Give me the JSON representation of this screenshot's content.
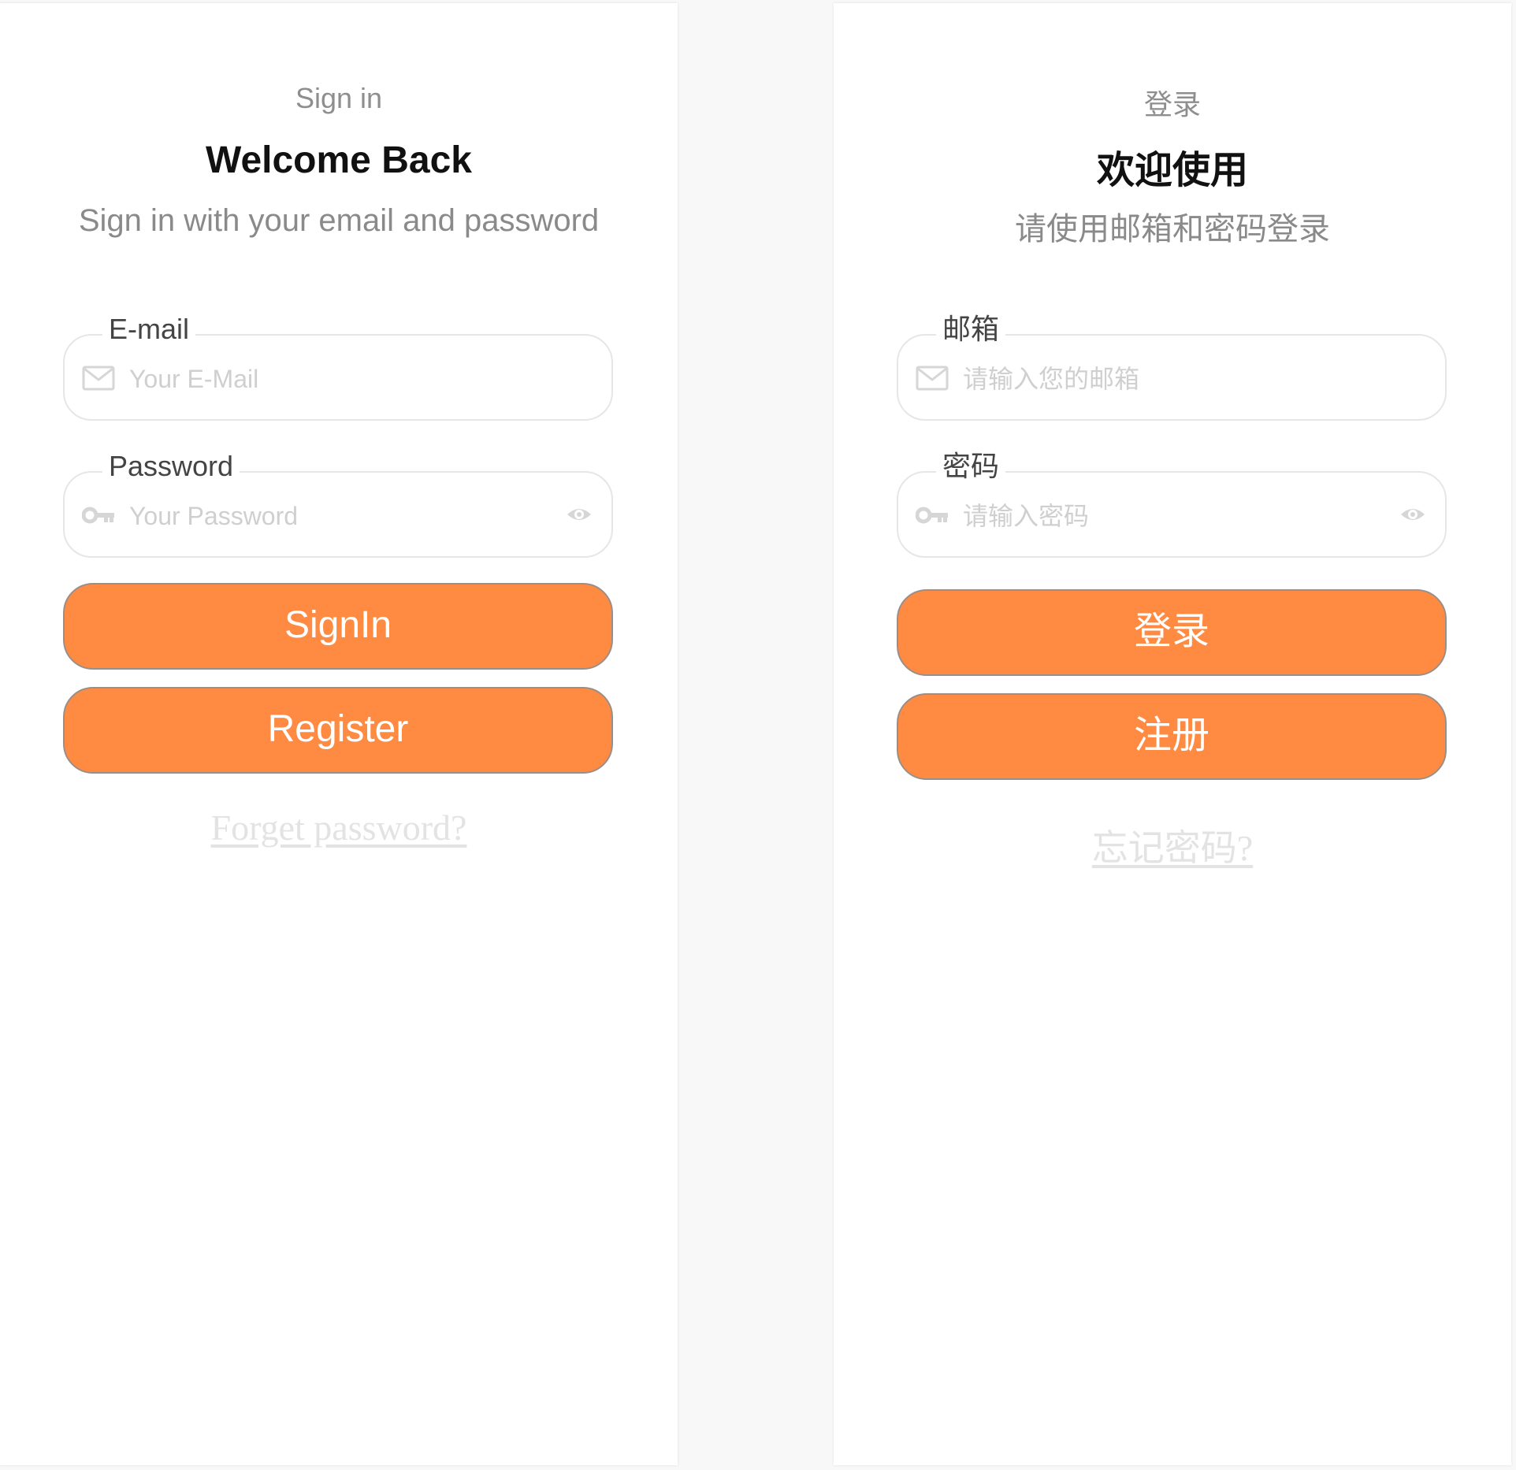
{
  "screens": [
    {
      "eyebrow": "Sign in",
      "title": "Welcome Back",
      "subtitle": "Sign in with your email and password",
      "email": {
        "label": "E-mail",
        "placeholder": "Your E-Mail",
        "icon": "mail-icon"
      },
      "password": {
        "label": "Password",
        "placeholder": "Your Password",
        "icon": "key-icon",
        "toggle_icon": "eye-icon"
      },
      "signin_label": "SignIn",
      "register_label": "Register",
      "forgot_label": "Forget password?"
    },
    {
      "eyebrow": "登录",
      "title": "欢迎使用",
      "subtitle": "请使用邮箱和密码登录",
      "email": {
        "label": "邮箱",
        "placeholder": "请输入您的邮箱",
        "icon": "mail-icon"
      },
      "password": {
        "label": "密码",
        "placeholder": "请输入密码",
        "icon": "key-icon",
        "toggle_icon": "eye-icon"
      },
      "signin_label": "登录",
      "register_label": "注册",
      "forgot_label": "忘记密码? "
    }
  ],
  "colors": {
    "button_bg": "#ff8a42",
    "button_text": "#ffffff",
    "placeholder": "#cfcfcf",
    "muted_text": "#8a8a8a",
    "forgot_link": "#e3e3e3"
  }
}
